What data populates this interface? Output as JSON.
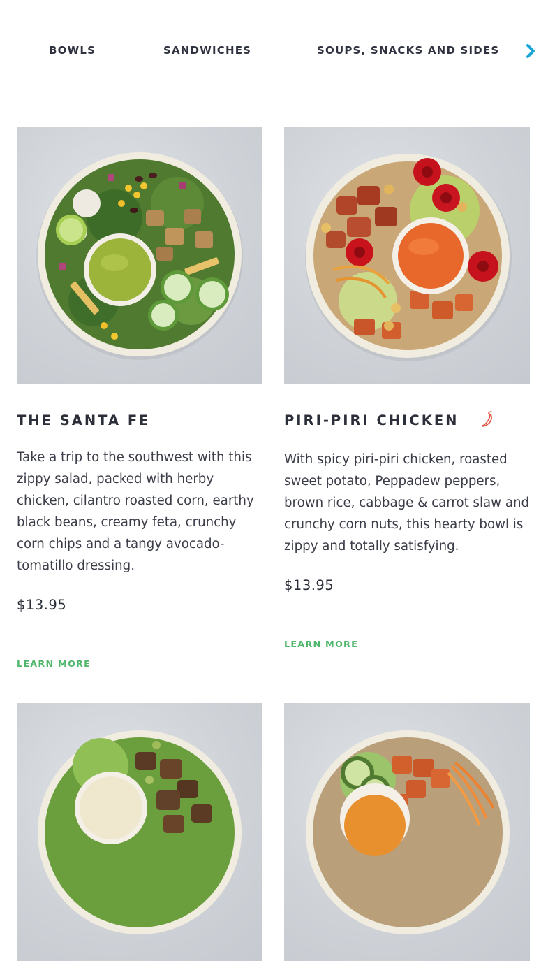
{
  "nav": {
    "tabs": [
      {
        "label": "BOWLS"
      },
      {
        "label": "SANDWICHES"
      },
      {
        "label": "SOUPS, SNACKS AND SIDES"
      }
    ],
    "arrow_icon": "chevron-right-icon",
    "accent_color": "#1aa7d6"
  },
  "cards": [
    {
      "title": "THE SANTA FE",
      "description": "Take a trip to the southwest with this zippy salad, packed with herby chicken, cilantro roasted corn, earthy black beans, creamy feta, crunchy corn chips and a tangy avocado-tomatillo dressing.",
      "price": "$13.95",
      "learn_more": "LEARN MORE"
    },
    {
      "title": "PIRI-PIRI CHICKEN",
      "spicy_icon": "chili-pepper-icon",
      "description": "With spicy piri-piri chicken, roasted sweet potato, Peppadew peppers, brown rice, cabbage & carrot slaw and crunchy corn nuts, this hearty bowl is zippy and totally satisfying.",
      "price": "$13.95",
      "learn_more": "LEARN MORE"
    }
  ],
  "colors": {
    "link_green": "#4fb76b",
    "chili_red": "#e0533f",
    "heading": "#2c2f3a"
  }
}
